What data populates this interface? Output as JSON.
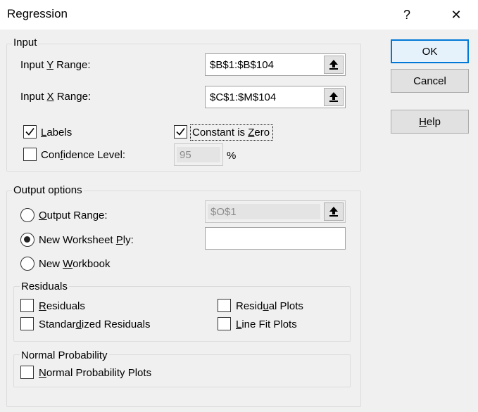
{
  "window": {
    "title": "Regression",
    "help_glyph": "?",
    "close_glyph": "✕"
  },
  "input": {
    "group_label": "Input",
    "y_range": {
      "label_pre": "Input ",
      "label_u": "Y",
      "label_post": " Range:",
      "value": "$B$1:$B$104"
    },
    "x_range": {
      "label_pre": "Input ",
      "label_u": "X",
      "label_post": " Range:",
      "value": "$C$1:$M$104"
    },
    "labels": {
      "label_u": "L",
      "label_post": "abels",
      "checked": true
    },
    "constant_zero": {
      "label_pre": "Constant is ",
      "label_u": "Z",
      "label_post": "ero",
      "checked": true
    },
    "confidence": {
      "label_pre": "Con",
      "label_u": "f",
      "label_post": "idence Level:",
      "checked": false,
      "value": "95",
      "unit": "%"
    }
  },
  "output": {
    "group_label": "Output options",
    "output_range": {
      "label_u": "O",
      "label_post": "utput Range:",
      "value": "$O$1",
      "selected": false
    },
    "new_worksheet": {
      "label_pre": "New Worksheet ",
      "label_u": "P",
      "label_post": "ly:",
      "value": "",
      "selected": true
    },
    "new_workbook": {
      "label_pre": "New ",
      "label_u": "W",
      "label_post": "orkbook",
      "selected": false
    }
  },
  "residuals": {
    "group_label": "Residuals",
    "residuals": {
      "label_u": "R",
      "label_post": "esiduals",
      "checked": false
    },
    "standardized": {
      "label_pre": "Standar",
      "label_u": "d",
      "label_post": "ized Residuals",
      "checked": false
    },
    "residual_plots": {
      "label_pre": "Resid",
      "label_u": "u",
      "label_post": "al Plots",
      "checked": false
    },
    "line_fit": {
      "label_u": "L",
      "label_post": "ine Fit Plots",
      "checked": false
    }
  },
  "normal": {
    "group_label": "Normal Probability",
    "plots": {
      "label_u": "N",
      "label_post": "ormal Probability Plots",
      "checked": false
    }
  },
  "buttons": {
    "ok": "OK",
    "cancel": "Cancel",
    "help_u": "H",
    "help_post": "elp"
  }
}
